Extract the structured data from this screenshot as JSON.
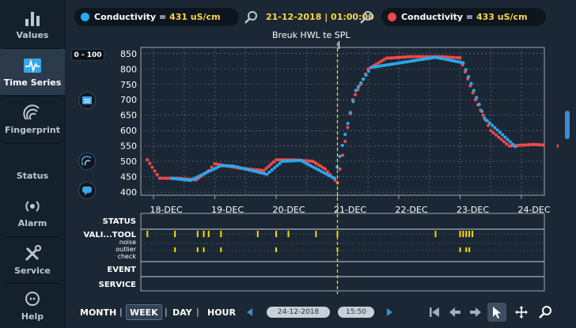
{
  "sidebar": {
    "items": [
      {
        "label": "Values",
        "icon": "bar-chart-icon"
      },
      {
        "label": "Time Series",
        "icon": "pulse-icon",
        "active": true
      },
      {
        "label": "Fingerprint",
        "icon": "fingerprint-icon"
      },
      {
        "label": "Status",
        "icon": ""
      },
      {
        "label": "Alarm",
        "icon": "broadcast-icon"
      },
      {
        "label": "Service",
        "icon": "tools-icon"
      },
      {
        "label": "Help",
        "icon": "help-chat-icon"
      }
    ]
  },
  "topbar": {
    "left_readout": {
      "label": "Conductivity",
      "eq": " = ",
      "value": "431 uS/cm",
      "color": "#29a9f0"
    },
    "datetime": "21-12-2018 | 01:00:00",
    "right_readout": {
      "label": "Conductivity",
      "eq": " = ",
      "value": "433 uS/cm",
      "color": "#f24848"
    },
    "event_label": "Breuk HWL te SPL"
  },
  "range_badge": "0 - 100",
  "chart_data": {
    "type": "scatter",
    "title": "",
    "xlabel": "",
    "ylabel": "",
    "x_ticks": [
      "18-DEC",
      "19-DEC",
      "20-DEC",
      "21-DEC",
      "22-DEC",
      "23-DEC",
      "24-DEC"
    ],
    "ylim": [
      390,
      870
    ],
    "y_ticks": [
      400,
      450,
      500,
      550,
      600,
      650,
      700,
      750,
      800,
      850
    ],
    "grid": true,
    "cursor_x": 3.0,
    "series": [
      {
        "color": "#f24848",
        "points": [
          [
            -0.1,
            505
          ],
          [
            0.1,
            445
          ],
          [
            0.4,
            445
          ],
          [
            0.7,
            440
          ],
          [
            0.9,
            470
          ],
          [
            1.0,
            492
          ],
          [
            1.4,
            478
          ],
          [
            1.8,
            470
          ],
          [
            2.0,
            505
          ],
          [
            2.3,
            505
          ],
          [
            2.6,
            500
          ],
          [
            2.8,
            475
          ],
          [
            3.0,
            430
          ],
          [
            3.25,
            700
          ],
          [
            3.5,
            800
          ],
          [
            3.8,
            835
          ],
          [
            4.2,
            840
          ],
          [
            4.7,
            840
          ],
          [
            5.0,
            836
          ],
          [
            5.25,
            700
          ],
          [
            5.5,
            600
          ],
          [
            5.8,
            550
          ],
          [
            6.2,
            555
          ],
          [
            6.6,
            550
          ]
        ]
      },
      {
        "color": "#29a9f0",
        "points": [
          [
            0.3,
            445
          ],
          [
            0.6,
            438
          ],
          [
            1.1,
            486
          ],
          [
            1.3,
            485
          ],
          [
            1.85,
            458
          ],
          [
            2.1,
            500
          ],
          [
            2.4,
            503
          ],
          [
            2.95,
            445
          ],
          [
            3.3,
            730
          ],
          [
            3.55,
            805
          ],
          [
            4.6,
            838
          ],
          [
            5.05,
            820
          ],
          [
            5.4,
            640
          ],
          [
            5.9,
            548
          ]
        ]
      }
    ]
  },
  "event_rows": {
    "labels": [
      "STATUS",
      "VALI...TOOL",
      "noise",
      "outlier",
      "check",
      "EVENT",
      "SERVICE"
    ],
    "validation_marks_x": [
      -0.1,
      0.35,
      0.72,
      0.82,
      0.9,
      1.1,
      1.7,
      2.0,
      2.2,
      2.65,
      3.0,
      4.6,
      5.0,
      5.05,
      5.1,
      5.15,
      5.2,
      6.6
    ],
    "outlier_marks_x": [
      0.35,
      0.72,
      0.82,
      1.1,
      2.0,
      3.0,
      5.0,
      5.1,
      5.15,
      6.6
    ],
    "mark_color": "#ffd800"
  },
  "bottombar": {
    "time_buttons": [
      {
        "label": "MONTH"
      },
      {
        "label": "WEEK",
        "selected": true
      },
      {
        "label": "DAY"
      },
      {
        "label": "HOUR"
      }
    ],
    "separator": "|",
    "date_value": "24-12-2018",
    "time_value": "15:50"
  },
  "colors": {
    "background": "#1b2734",
    "sidebar": "#14202c",
    "accent": "#29a9f0",
    "series_red": "#f24848",
    "highlight": "#ffd54a",
    "cursor": "#ffd800"
  }
}
